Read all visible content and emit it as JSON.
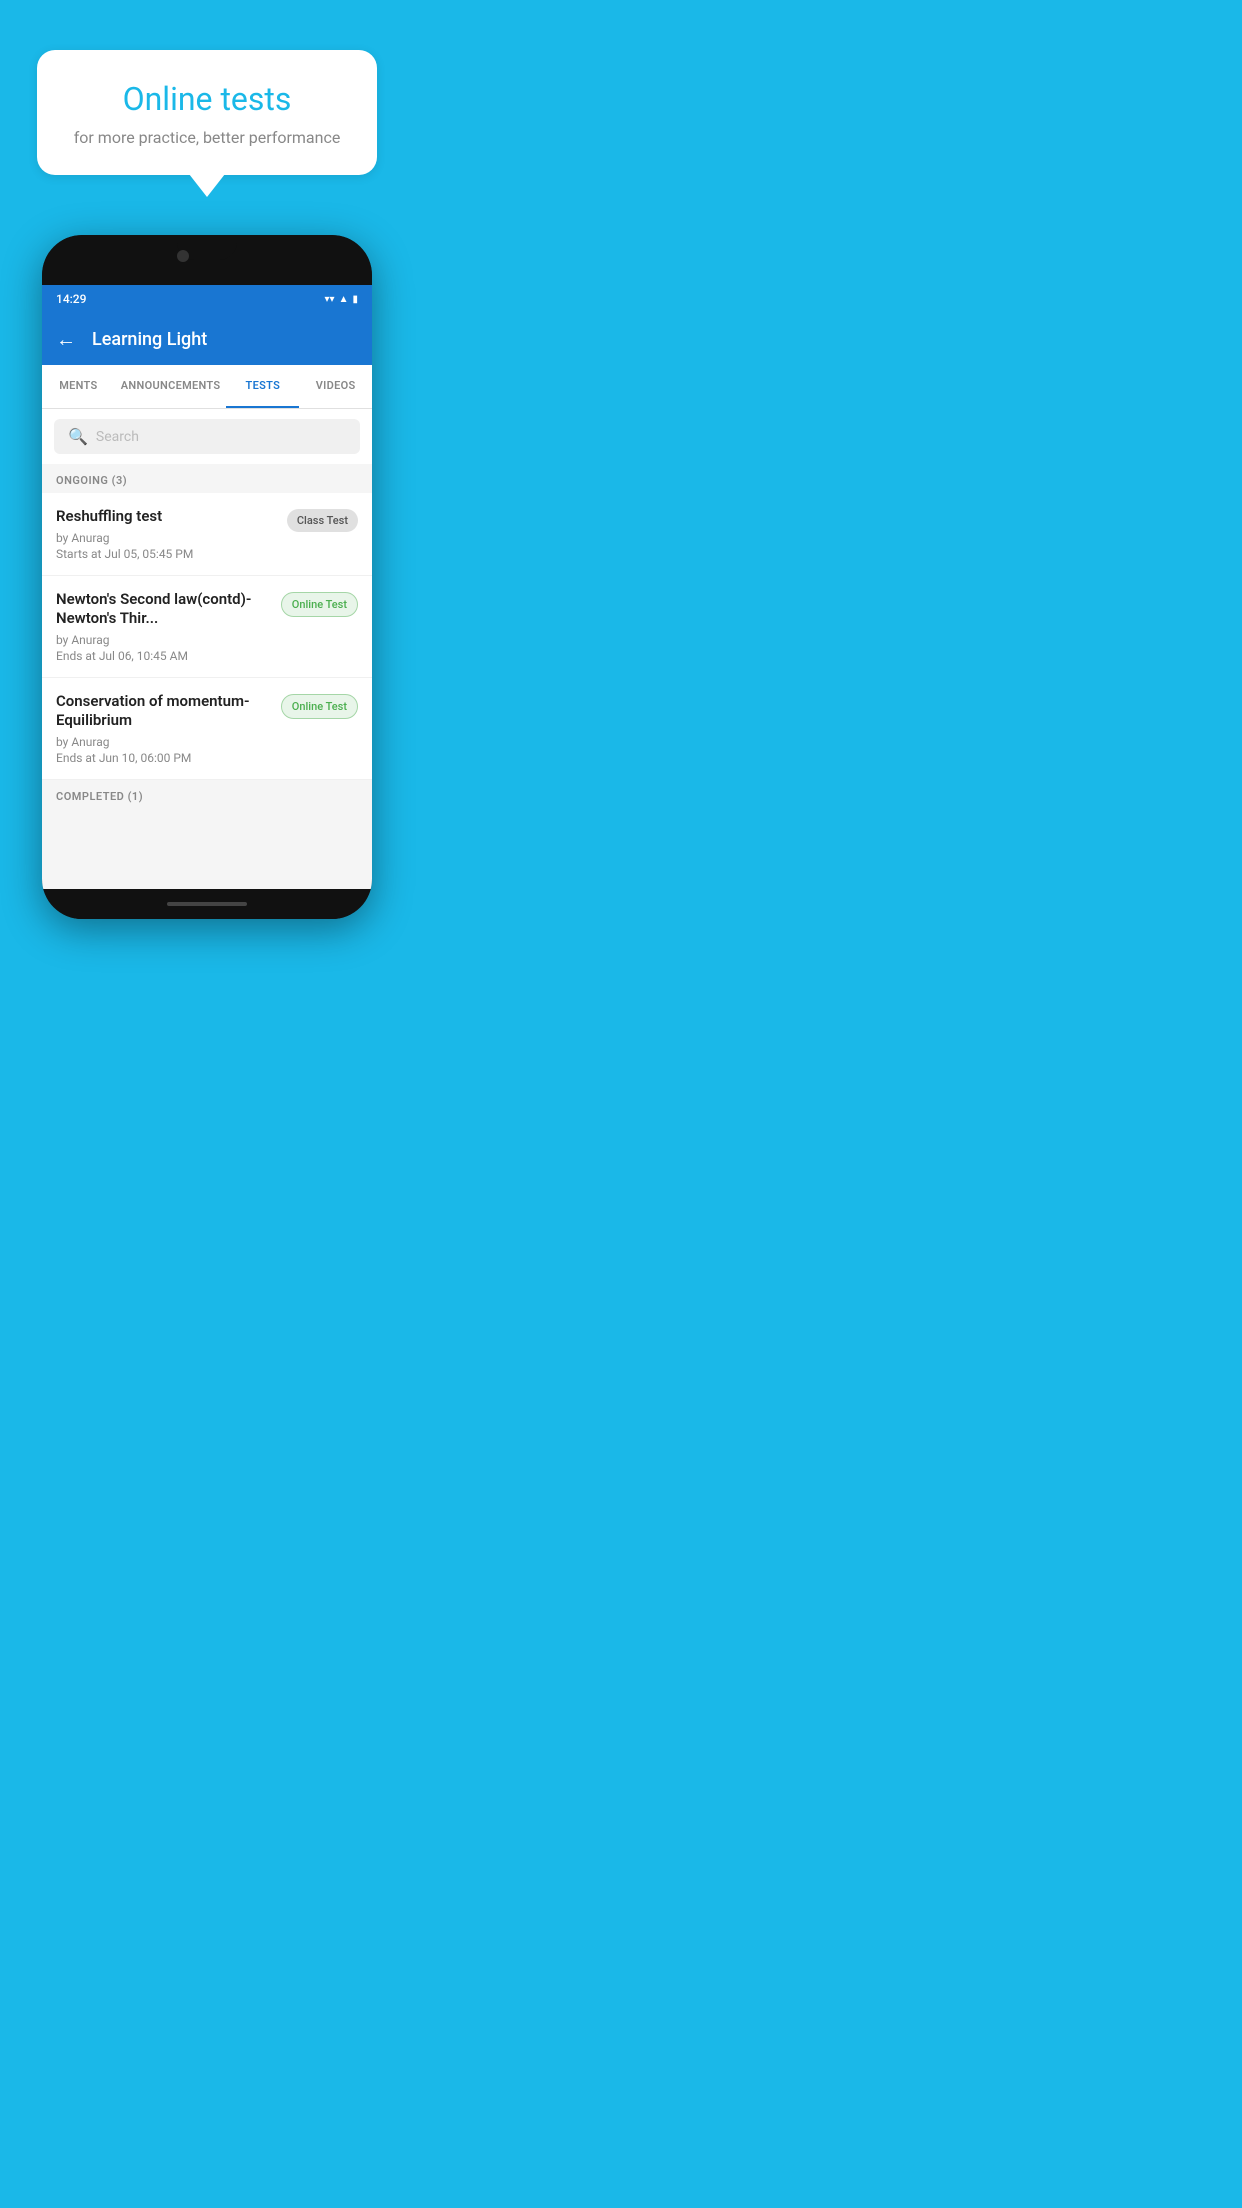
{
  "background_color": "#1ab8e8",
  "speech_bubble": {
    "title": "Online tests",
    "subtitle": "for more practice, better performance"
  },
  "phone": {
    "status_bar": {
      "time": "14:29",
      "icons": [
        "wifi",
        "signal",
        "battery"
      ]
    },
    "app_bar": {
      "title": "Learning Light",
      "back_label": "←"
    },
    "tabs": [
      {
        "label": "MENTS",
        "active": false
      },
      {
        "label": "ANNOUNCEMENTS",
        "active": false
      },
      {
        "label": "TESTS",
        "active": true
      },
      {
        "label": "VIDEOS",
        "active": false
      }
    ],
    "search": {
      "placeholder": "Search"
    },
    "sections": [
      {
        "header": "ONGOING (3)",
        "items": [
          {
            "name": "Reshuffling test",
            "author": "by Anurag",
            "date": "Starts at  Jul 05, 05:45 PM",
            "badge": "Class Test",
            "badge_type": "class"
          },
          {
            "name": "Newton's Second law(contd)-Newton's Thir...",
            "author": "by Anurag",
            "date": "Ends at  Jul 06, 10:45 AM",
            "badge": "Online Test",
            "badge_type": "online"
          },
          {
            "name": "Conservation of momentum-Equilibrium",
            "author": "by Anurag",
            "date": "Ends at  Jun 10, 06:00 PM",
            "badge": "Online Test",
            "badge_type": "online"
          }
        ]
      }
    ],
    "completed_header": "COMPLETED (1)"
  }
}
